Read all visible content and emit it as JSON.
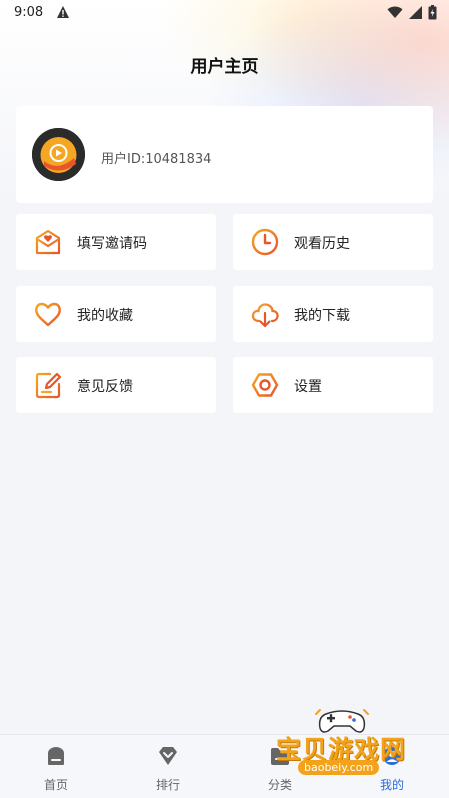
{
  "status_bar": {
    "time": "9:08"
  },
  "header": {
    "title": "用户主页"
  },
  "profile": {
    "user_id": "用户ID:10481834"
  },
  "menu": [
    {
      "label": "填写邀请码",
      "icon": "mail-heart-icon"
    },
    {
      "label": "观看历史",
      "icon": "clock-icon"
    },
    {
      "label": "我的收藏",
      "icon": "heart-icon"
    },
    {
      "label": "我的下载",
      "icon": "cloud-download-icon"
    },
    {
      "label": "意见反馈",
      "icon": "edit-note-icon"
    },
    {
      "label": "设置",
      "icon": "hexagon-gear-icon"
    }
  ],
  "tabs": [
    {
      "label": "首页",
      "icon": "home-icon"
    },
    {
      "label": "排行",
      "icon": "ranking-icon"
    },
    {
      "label": "分类",
      "icon": "category-icon"
    },
    {
      "label": "我的",
      "icon": "profile-icon",
      "active": true
    }
  ],
  "watermark": {
    "text": "宝贝游戏网",
    "url": "baobeiy.com"
  },
  "colors": {
    "accent_orange": "#e8572a",
    "accent_yellow": "#f5a623",
    "tab_active": "#2c6bd8"
  }
}
